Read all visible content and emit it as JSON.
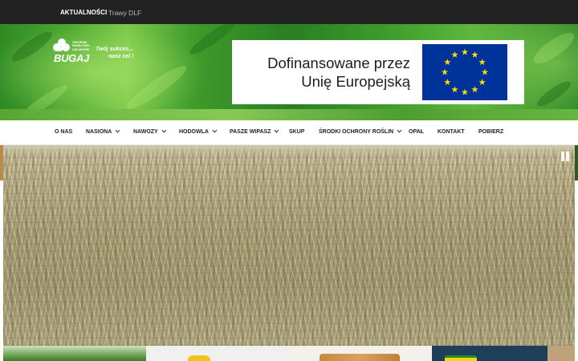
{
  "topbar": {
    "links": [
      {
        "label": "AKTUALNOŚCI",
        "active": true
      },
      {
        "label": "Trawy DLF",
        "active": false
      }
    ]
  },
  "header": {
    "logo": {
      "small_lines": [
        "CENTRUM",
        "HANDLOWO",
        "USŁUGOWE"
      ],
      "brand": "BUGAJ"
    },
    "slogan": [
      "Twój sukces...",
      "nasz cel !"
    ],
    "eu_banner": {
      "lines": [
        "Dofinansowane przez",
        "Unię Europejską"
      ],
      "flag_color": "#003399",
      "star_color": "#FFDD00"
    }
  },
  "nav": {
    "items": [
      {
        "label": "O NAS",
        "dropdown": false
      },
      {
        "label": "NASIONA",
        "dropdown": true
      },
      {
        "label": "NAWOZY",
        "dropdown": true
      },
      {
        "label": "HODOWLA",
        "dropdown": true
      },
      {
        "label": "PASZE WIPASZ",
        "dropdown": true
      },
      {
        "label": "SKUP",
        "dropdown": false
      },
      {
        "label": "ŚRODKI OCHRONY ROŚLIN",
        "dropdown": true
      },
      {
        "label": "OPAŁ",
        "dropdown": false
      },
      {
        "label": "KONTAKT",
        "dropdown": false
      },
      {
        "label": "POBIERZ",
        "dropdown": false
      }
    ]
  },
  "hero": {
    "pause_icon": "pause-icon"
  },
  "colors": {
    "topbar": "#222222",
    "nav_text": "#222222",
    "header_green": "#3c9a2c"
  }
}
